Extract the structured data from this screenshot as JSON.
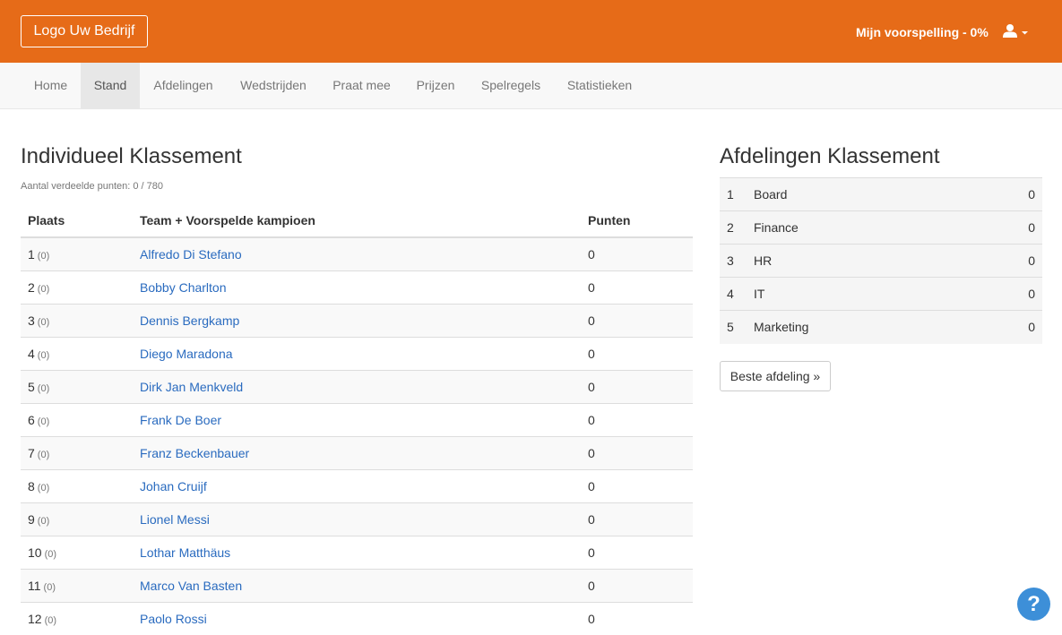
{
  "header": {
    "logo_label": "Logo Uw Bedrijf",
    "prediction_label": "Mijn voorspelling - 0%",
    "user_icon": "user-icon",
    "caret_icon": "caret-down-icon",
    "brand_color": "#e66b18"
  },
  "nav": {
    "items": [
      {
        "label": "Home"
      },
      {
        "label": "Stand"
      },
      {
        "label": "Afdelingen"
      },
      {
        "label": "Wedstrijden"
      },
      {
        "label": "Praat mee"
      },
      {
        "label": "Prijzen"
      },
      {
        "label": "Spelregels"
      },
      {
        "label": "Statistieken"
      }
    ],
    "active": "Stand"
  },
  "individual": {
    "title": "Individueel Klassement",
    "subtitle": "Aantal verdeelde punten: 0 / 780",
    "columns": [
      "Plaats",
      "Team + Voorspelde kampioen",
      "Punten"
    ],
    "rows": [
      {
        "rank": "1",
        "prev": "(0)",
        "name": "Alfredo Di Stefano",
        "points": "0"
      },
      {
        "rank": "2",
        "prev": "(0)",
        "name": "Bobby Charlton",
        "points": "0"
      },
      {
        "rank": "3",
        "prev": "(0)",
        "name": "Dennis Bergkamp",
        "points": "0"
      },
      {
        "rank": "4",
        "prev": "(0)",
        "name": "Diego Maradona",
        "points": "0"
      },
      {
        "rank": "5",
        "prev": "(0)",
        "name": "Dirk Jan Menkveld",
        "points": "0"
      },
      {
        "rank": "6",
        "prev": "(0)",
        "name": "Frank De Boer",
        "points": "0"
      },
      {
        "rank": "7",
        "prev": "(0)",
        "name": "Franz Beckenbauer",
        "points": "0"
      },
      {
        "rank": "8",
        "prev": "(0)",
        "name": "Johan Cruijf",
        "points": "0"
      },
      {
        "rank": "9",
        "prev": "(0)",
        "name": "Lionel Messi",
        "points": "0"
      },
      {
        "rank": "10",
        "prev": "(0)",
        "name": "Lothar Matthäus",
        "points": "0"
      },
      {
        "rank": "11",
        "prev": "(0)",
        "name": "Marco Van Basten",
        "points": "0"
      },
      {
        "rank": "12",
        "prev": "(0)",
        "name": "Paolo Rossi",
        "points": "0"
      }
    ]
  },
  "departments": {
    "title": "Afdelingen Klassement",
    "rows": [
      {
        "rank": "1",
        "name": "Board",
        "points": "0"
      },
      {
        "rank": "2",
        "name": "Finance",
        "points": "0"
      },
      {
        "rank": "3",
        "name": "HR",
        "points": "0"
      },
      {
        "rank": "4",
        "name": "IT",
        "points": "0"
      },
      {
        "rank": "5",
        "name": "Marketing",
        "points": "0"
      }
    ],
    "button_label": "Beste afdeling »"
  },
  "help": {
    "label": "?",
    "icon": "help-icon"
  }
}
